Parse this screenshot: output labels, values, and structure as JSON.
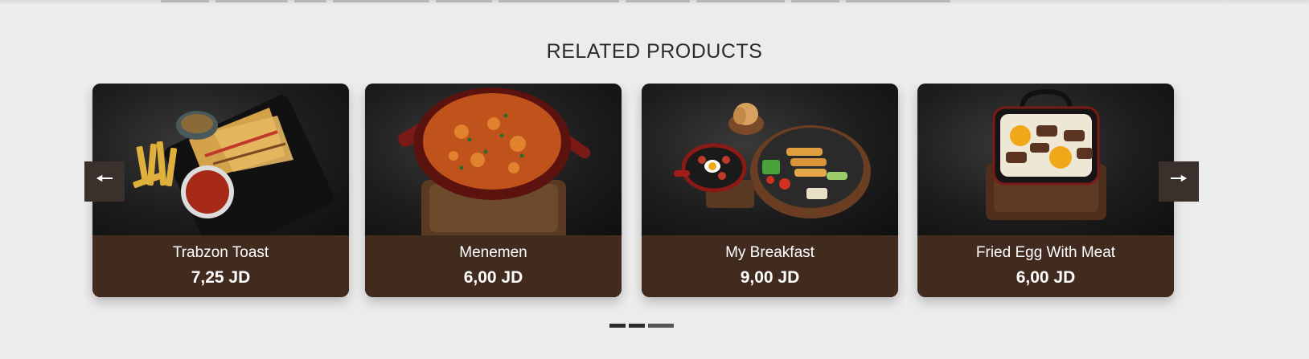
{
  "section": {
    "title": "RELATED PRODUCTS"
  },
  "products": [
    {
      "name": "Trabzon Toast",
      "price": "7,25 JD"
    },
    {
      "name": "Menemen",
      "price": "6,00 JD"
    },
    {
      "name": "My Breakfast",
      "price": "9,00 JD"
    },
    {
      "name": "Fried Egg With Meat",
      "price": "6,00 JD"
    }
  ],
  "navigation": {
    "prev_icon": "arrow-left-icon",
    "next_icon": "arrow-right-icon",
    "prev_glyph": "🠔",
    "next_glyph": "🠖"
  },
  "pagination": {
    "count": 3,
    "active_index": 2
  },
  "colors": {
    "card_footer": "#412b1e",
    "page_background": "#ececec",
    "arrow_background": "#3a302c"
  }
}
